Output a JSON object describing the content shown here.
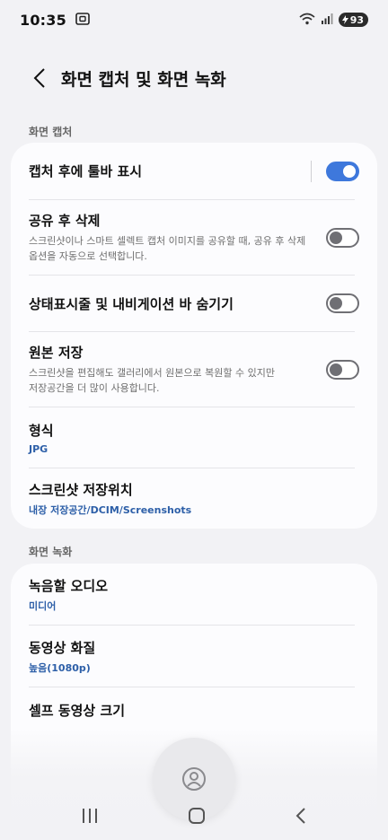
{
  "status_bar": {
    "time": "10:35",
    "battery": "93"
  },
  "header": {
    "title": "화면 캡처 및 화면 녹화"
  },
  "sections": {
    "capture_label": "화면 캡처",
    "recording_label": "화면 녹화"
  },
  "capture": {
    "toolbar": {
      "title": "캡처 후에 툴바 표시",
      "enabled": true
    },
    "delete_after_share": {
      "title": "공유 후 삭제",
      "desc1": "스크린샷이나 스마트 셀렉트 캡처 이미지를 공유할 때, 공유 후 삭제",
      "desc2": "옵션을 자동으로 선택합니다.",
      "enabled": false
    },
    "hide_bars": {
      "title": "상태표시줄 및 내비게이션 바 숨기기",
      "enabled": false
    },
    "save_original": {
      "title": "원본 저장",
      "desc1": "스크린샷을 편집해도 갤러리에서 원본으로 복원할 수 있지만",
      "desc2": "저장공간을 더 많이 사용합니다.",
      "enabled": false
    },
    "format": {
      "title": "형식",
      "value": "JPG"
    },
    "location": {
      "title": "스크린샷 저장위치",
      "value": "내장 저장공간/DCIM/Screenshots"
    }
  },
  "recording": {
    "audio": {
      "title": "녹음할 오디오",
      "value": "미디어"
    },
    "quality": {
      "title": "동영상 화질",
      "value": "높음(1080p)"
    },
    "selfie_size": {
      "title": "셀프 동영상 크기"
    }
  },
  "colors": {
    "accent": "#3e78dc",
    "value_text": "#2d5fa8"
  }
}
